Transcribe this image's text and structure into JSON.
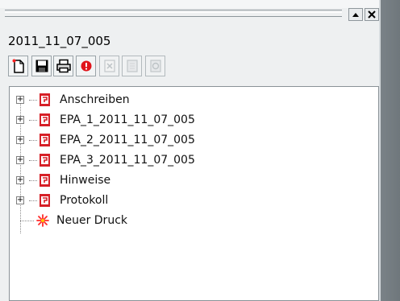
{
  "window": {
    "document_id": "2011_11_07_005"
  },
  "toolbar": {
    "buttons": [
      {
        "name": "new-document-icon",
        "enabled": true
      },
      {
        "name": "save-icon",
        "enabled": true
      },
      {
        "name": "print-icon",
        "enabled": true
      },
      {
        "name": "stop-icon",
        "enabled": true
      },
      {
        "name": "delete-icon",
        "enabled": false
      },
      {
        "name": "page-icon",
        "enabled": false
      },
      {
        "name": "refresh-icon",
        "enabled": false
      }
    ]
  },
  "tree": {
    "items": [
      {
        "label": "Anschreiben",
        "icon": "pdf-document-icon",
        "expandable": true
      },
      {
        "label": "EPA_1_2011_11_07_005",
        "icon": "pdf-document-icon",
        "expandable": true
      },
      {
        "label": "EPA_2_2011_11_07_005",
        "icon": "pdf-document-icon",
        "expandable": true
      },
      {
        "label": "EPA_3_2011_11_07_005",
        "icon": "pdf-document-icon",
        "expandable": true
      },
      {
        "label": "Hinweise",
        "icon": "pdf-document-icon",
        "expandable": true
      },
      {
        "label": "Protokoll",
        "icon": "pdf-document-icon",
        "expandable": true
      },
      {
        "label": "Neuer Druck",
        "icon": "new-star-icon",
        "expandable": false
      }
    ]
  },
  "colors": {
    "pdf_red": "#d61f26",
    "accent_star": "#ff2a2a",
    "panel": "#eef0f1"
  }
}
